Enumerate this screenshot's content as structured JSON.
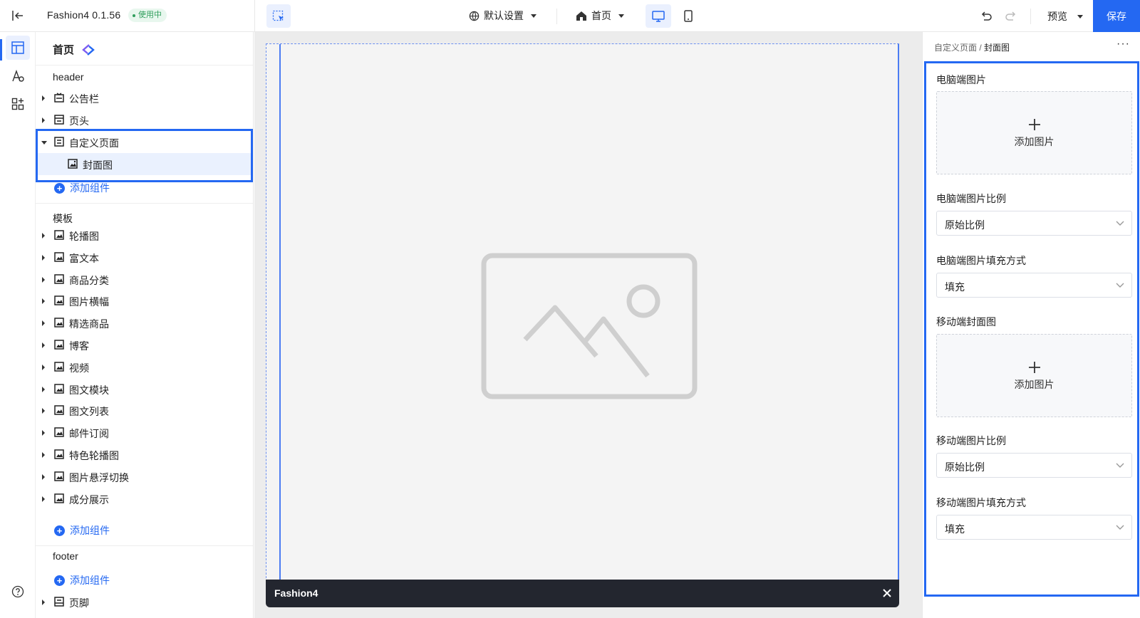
{
  "topbar": {
    "app_name": "Fashion4 0.1.56",
    "status_badge": "使用中",
    "settings_label": "默认设置",
    "page_label": "首页",
    "preview_label": "预览",
    "save_label": "保存"
  },
  "rail": {
    "items": [
      "layout-icon",
      "theme-icon",
      "apps-icon"
    ],
    "help": "help-icon"
  },
  "left_panel": {
    "page_title": "首页",
    "header_section": "header",
    "header_items": [
      {
        "label": "公告栏",
        "icon": "announcement-icon"
      },
      {
        "label": "页头",
        "icon": "header-icon"
      },
      {
        "label": "自定义页面",
        "icon": "custom-page-icon"
      }
    ],
    "custom_child": {
      "label": "封面图",
      "icon": "image-icon"
    },
    "add_component": "添加组件",
    "template_section": "模板",
    "template_items": [
      {
        "label": "轮播图",
        "icon": "carousel-icon"
      },
      {
        "label": "富文本",
        "icon": "richtext-icon"
      },
      {
        "label": "商品分类",
        "icon": "category-icon"
      },
      {
        "label": "图片横幅",
        "icon": "banner-icon"
      },
      {
        "label": "精选商品",
        "icon": "featured-icon"
      },
      {
        "label": "博客",
        "icon": "blog-icon"
      },
      {
        "label": "视频",
        "icon": "video-icon"
      },
      {
        "label": "图文模块",
        "icon": "imagetext-icon"
      },
      {
        "label": "图文列表",
        "icon": "imagelist-icon"
      },
      {
        "label": "邮件订阅",
        "icon": "mail-icon"
      },
      {
        "label": "特色轮播图",
        "icon": "carousel-icon"
      },
      {
        "label": "图片悬浮切换",
        "icon": "hover-image-icon"
      },
      {
        "label": "成分展示",
        "icon": "ingredient-icon"
      }
    ],
    "footer_section": "footer",
    "footer_items": [
      {
        "label": "页脚",
        "icon": "footer-icon"
      }
    ]
  },
  "canvas": {
    "brand": "Fashion4"
  },
  "right_panel": {
    "breadcrumb_parent": "自定义页面",
    "breadcrumb_sep": "/",
    "breadcrumb_current": "封面图",
    "desktop_image_label": "电脑端图片",
    "add_image": "添加图片",
    "desktop_ratio_label": "电脑端图片比例",
    "desktop_ratio_value": "原始比例",
    "desktop_fill_label": "电脑端图片填充方式",
    "desktop_fill_value": "填充",
    "mobile_image_label": "移动端封面图",
    "mobile_ratio_label": "移动端图片比例",
    "mobile_ratio_value": "原始比例",
    "mobile_fill_label": "移动端图片填充方式",
    "mobile_fill_value": "填充"
  },
  "colors": {
    "accent": "#2468f2",
    "status_green": "#2f9e5c",
    "footer_bar": "#23262f"
  }
}
